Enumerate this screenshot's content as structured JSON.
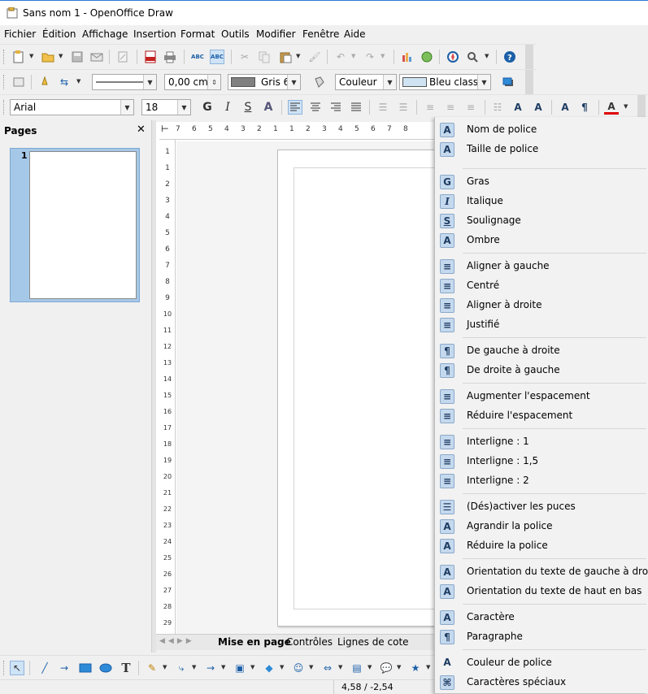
{
  "window": {
    "title": "Sans nom 1 - OpenOffice Draw"
  },
  "menu": [
    "Fichier",
    "Édition",
    "Affichage",
    "Insertion",
    "Format",
    "Outils",
    "Modifier",
    "Fenêtre",
    "Aide"
  ],
  "line_toolbar": {
    "line_width": "0,00 cm",
    "fill_color": "Gris 6",
    "area_style": "Couleur",
    "area_fill": "Bleu classique",
    "line_color_swatch": "#808080",
    "area_fill_swatch": "#cfe3f2"
  },
  "text_toolbar": {
    "font_name": "Arial",
    "font_size": "18",
    "bold_glyph": "G",
    "italic_glyph": "I",
    "underline_glyph": "S"
  },
  "pages_pane": {
    "title": "Pages",
    "page_number": "1"
  },
  "ruler": {
    "h_labels": [
      "7",
      "6",
      "5",
      "4",
      "3",
      "2",
      "1",
      "1",
      "2",
      "3",
      "4",
      "5",
      "6",
      "7",
      "8"
    ],
    "v_labels": [
      "1",
      "1",
      "2",
      "3",
      "4",
      "5",
      "6",
      "7",
      "8",
      "9",
      "10",
      "11",
      "12",
      "13",
      "14",
      "15",
      "16",
      "17",
      "18",
      "19",
      "20",
      "21",
      "22",
      "23",
      "24",
      "25",
      "26",
      "27",
      "28",
      "29"
    ]
  },
  "tabs": [
    "Mise en page",
    "Contrôles",
    "Lignes de cote"
  ],
  "status": {
    "position": "4,58 / -2,54"
  },
  "context_menu": {
    "items": [
      {
        "label": "Nom de police",
        "icon": "font-name-icon",
        "glyph": "A"
      },
      {
        "label": "Taille de police",
        "icon": "font-size-icon",
        "glyph": "A"
      },
      {
        "label": "Gras",
        "icon": "bold-icon",
        "glyph": "G"
      },
      {
        "label": "Italique",
        "icon": "italic-icon",
        "glyph": "I"
      },
      {
        "label": "Soulignage",
        "icon": "underline-icon",
        "glyph": "S"
      },
      {
        "label": "Ombre",
        "icon": "shadow-icon",
        "glyph": "A"
      },
      {
        "label": "Aligner à gauche",
        "icon": "align-left-icon",
        "glyph": "≡"
      },
      {
        "label": "Centré",
        "icon": "align-center-icon",
        "glyph": "≡"
      },
      {
        "label": "Aligner à droite",
        "icon": "align-right-icon",
        "glyph": "≡"
      },
      {
        "label": "Justifié",
        "icon": "justify-icon",
        "glyph": "≡"
      },
      {
        "label": "De gauche à droite",
        "icon": "ltr-icon",
        "glyph": "¶"
      },
      {
        "label": "De droite à gauche",
        "icon": "rtl-icon",
        "glyph": "¶"
      },
      {
        "label": "Augmenter l'espacement",
        "icon": "increase-spacing-icon",
        "glyph": "≡"
      },
      {
        "label": "Réduire l'espacement",
        "icon": "decrease-spacing-icon",
        "glyph": "≡"
      },
      {
        "label": "Interligne : 1",
        "icon": "line-spacing-1-icon",
        "glyph": "≡"
      },
      {
        "label": "Interligne : 1,5",
        "icon": "line-spacing-15-icon",
        "glyph": "≡"
      },
      {
        "label": "Interligne : 2",
        "icon": "line-spacing-2-icon",
        "glyph": "≡"
      },
      {
        "label": "(Dés)activer les puces",
        "icon": "bullets-icon",
        "glyph": "☰"
      },
      {
        "label": "Agrandir la police",
        "icon": "grow-font-icon",
        "glyph": "A"
      },
      {
        "label": "Réduire la police",
        "icon": "shrink-font-icon",
        "glyph": "A"
      },
      {
        "label": "Orientation du texte de gauche à droite",
        "icon": "text-horizontal-icon",
        "glyph": "A"
      },
      {
        "label": "Orientation du texte de haut en bas",
        "icon": "text-vertical-icon",
        "glyph": "A"
      },
      {
        "label": "Caractère",
        "icon": "character-icon",
        "glyph": "A"
      },
      {
        "label": "Paragraphe",
        "icon": "paragraph-icon",
        "glyph": "¶"
      },
      {
        "label": "Couleur de police",
        "icon": "font-color-icon",
        "glyph": "A"
      },
      {
        "label": "Caractères spéciaux",
        "icon": "special-chars-icon",
        "glyph": "⌘"
      }
    ]
  }
}
